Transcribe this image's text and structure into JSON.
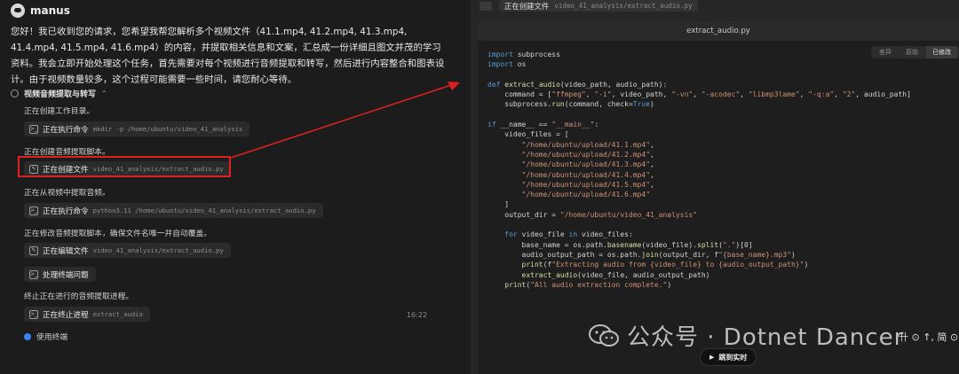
{
  "brand": {
    "name": "manus"
  },
  "message": "您好！我已收到您的请求，您希望我帮您解析多个视频文件（41.1.mp4, 41.2.mp4, 41.3.mp4, 41.4.mp4, 41.5.mp4, 41.6.mp4）的内容，并提取相关信息和文案，汇总成一份详细且图文并茂的学习资料。我会立即开始处理这个任务，首先需要对每个视频进行音频提取和转写，然后进行内容整合和图表设计。由于视频数量较多，这个过程可能需要一些时间，请您耐心等待。",
  "section": {
    "title": "视频音频提取与转写",
    "chevron": "⌃"
  },
  "steps": [
    {
      "text": "正在创建工作目录。",
      "tool_label": "正在执行命令",
      "tool_arg": "mkdir -p /home/ubuntu/video_41_analysis",
      "tool_icon": "terminal-icon"
    },
    {
      "text": "正在创建音频提取脚本。",
      "tool_label": "正在创建文件",
      "tool_arg": "video_41_analysis/extract_audio.py",
      "tool_icon": "file-edit-icon"
    },
    {
      "text": "正在从视频中提取音频。",
      "tool_label": "正在执行命令",
      "tool_arg": "python3.11 /home/ubuntu/video_41_analysis/extract_audio.py",
      "tool_icon": "terminal-icon"
    },
    {
      "text": "正在修改音频提取脚本，确保文件名唯一并自动覆盖。",
      "tool_label": "正在编辑文件",
      "tool_arg": "video_41_analysis/extract_audio.py",
      "tool_icon": "file-edit-icon"
    },
    {
      "text": "",
      "tool_label": "处理终端问题",
      "tool_arg": "",
      "tool_icon": "terminal-icon"
    },
    {
      "text": "终止正在进行的音频提取进程。",
      "tool_label": "正在终止进程",
      "tool_arg": "extract_audio",
      "tool_icon": "terminal-icon"
    }
  ],
  "timestamp": "16:22",
  "terminal_use": {
    "label": "使用终端"
  },
  "right_header": {
    "label": "正在创建文件",
    "path": "video_41_analysis/extract_audio.py"
  },
  "editor": {
    "filename": "extract_audio.py",
    "modes": [
      "差异",
      "原始",
      "已修改"
    ],
    "active_mode": "已修改"
  },
  "jump_button": {
    "icon": "▶",
    "label": "跳到实时"
  },
  "watermark": {
    "text": "公众号 · Dotnet Dancer",
    "extra": "卄 ⊙ ↑, 简 ⊙"
  },
  "colors": {
    "accent_red": "#e02020",
    "keyword": "#569cd6",
    "string": "#ce9178",
    "function": "#dcdcaa",
    "blue_dot": "#3b82f6"
  }
}
